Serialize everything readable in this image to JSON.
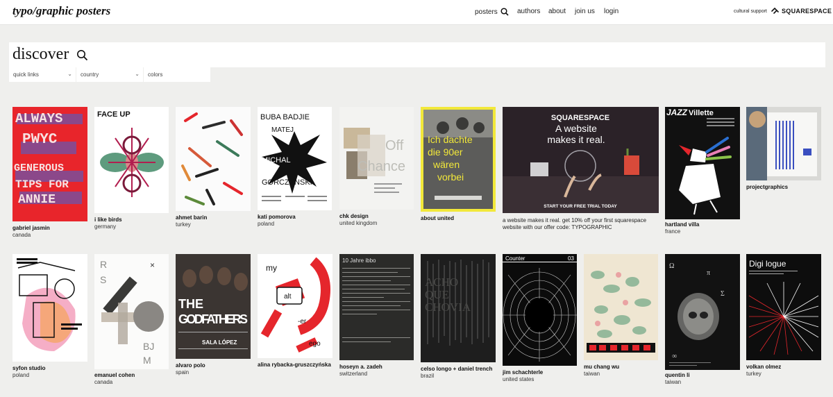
{
  "header": {
    "logo": "typo/graphic posters",
    "nav": {
      "posters": "posters",
      "authors": "authors",
      "about": "about",
      "join_us": "join us",
      "login": "login"
    },
    "support_text": "cultural support",
    "sponsor": "SQUARESPACE"
  },
  "search": {
    "title": "discover"
  },
  "filters": {
    "quick_links": "quick links",
    "country": "country",
    "colors": "colors"
  },
  "posters_row1": [
    {
      "author": "gabriel jasmin",
      "country": "canada",
      "poster_text": [
        "ALWAYS",
        "PWYC",
        "GENEROUS",
        "TIPS FOR",
        "ANNIE"
      ]
    },
    {
      "author": "i like birds",
      "country": "germany",
      "poster_text": [
        "FACE UP"
      ]
    },
    {
      "author": "ahmet barin",
      "country": "turkey"
    },
    {
      "author": "kati pomorova",
      "country": "poland",
      "poster_text": [
        "BUBA BADJIE",
        "MATEJ",
        "MICHAL",
        "GORCZYNSKI"
      ]
    },
    {
      "author": "chk design",
      "country": "united kingdom",
      "poster_text": [
        "Off",
        "Chance"
      ]
    },
    {
      "author": "about united",
      "country": "",
      "poster_text": [
        "Ich dachte",
        "die 90er",
        "wären",
        "vorbei"
      ]
    },
    {
      "ad_text": "a website makes it real. get 10% off your first squarespace website with our offer code: TYPOGRAPHIC",
      "poster_text": [
        "SQUARESPACE",
        "A website",
        "makes it real.",
        "START YOUR FREE TRIAL TODAY"
      ]
    },
    {
      "author": "hartland villa",
      "country": "france",
      "poster_text": [
        "JAZZ",
        "Villette"
      ]
    },
    {
      "author": "projectgraphics",
      "country": ""
    }
  ],
  "posters_row2": [
    {
      "author": "syfon studio",
      "country": "poland"
    },
    {
      "author": "emanuel cohen",
      "country": "canada",
      "poster_text": [
        "R",
        "S",
        "BJ",
        "M"
      ]
    },
    {
      "author": "alvaro polo",
      "country": "spain",
      "poster_text": [
        "THE",
        "GODFATHERS",
        "SALA LÓPEZ"
      ]
    },
    {
      "author": "alina rybacka-gruszczyńska",
      "country": "",
      "poster_text": [
        "my",
        "alt",
        "-er",
        "ego"
      ]
    },
    {
      "author": "hoseyn a. zadeh",
      "country": "switzerland",
      "poster_text": [
        "10 Jahre ibbo"
      ]
    },
    {
      "author": "celso longo + daniel trench",
      "country": "brazil",
      "poster_text": [
        "ACHO",
        "QUE",
        "CHOVIA"
      ]
    },
    {
      "author": "jim schachterle",
      "country": "united states",
      "poster_text": [
        "Counter",
        "03"
      ]
    },
    {
      "author": "mu chang wu",
      "country": "taiwan"
    },
    {
      "author": "quentin li",
      "country": "taiwan"
    },
    {
      "author": "volkan olmez",
      "country": "turkey",
      "poster_text": [
        "Digi logue"
      ]
    }
  ],
  "colors": {
    "accent_red": "#e5262c",
    "accent_blue": "#3a5fd0",
    "yellow": "#f2e83a",
    "background": "#efefed"
  }
}
